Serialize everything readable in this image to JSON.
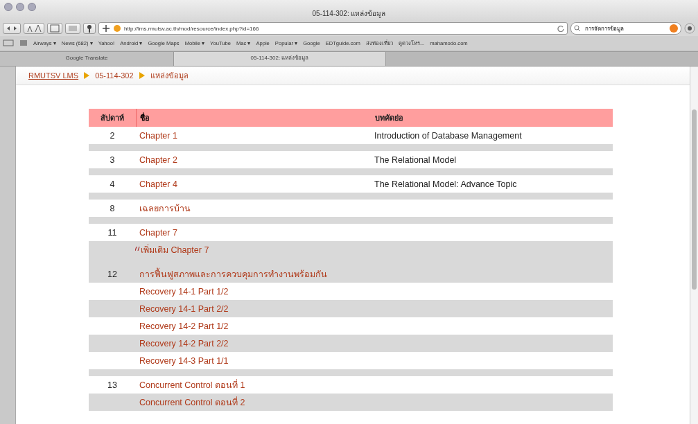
{
  "window": {
    "title": "05-114-302: แหล่งข้อมูล"
  },
  "toolbar": {
    "address": "http://lms.rmutsv.ac.th/mod/resource/index.php?id=166",
    "search": "การจัดการข้อมูล"
  },
  "bookmarks": [
    "Airways ▾",
    "News (682) ▾",
    "Yahoo!",
    "Android ▾",
    "Google Maps",
    "Mobile ▾",
    "YouTube",
    "Mac ▾",
    "Apple",
    "Popular ▾",
    "Google",
    "EDTguide.com",
    "ส่งท่องเที่ยว",
    "ดูดวงโหร...",
    "mahamodo.com"
  ],
  "tabs": [
    {
      "label": "Google Translate",
      "selected": false
    },
    {
      "label": "05-114-302: แหล่งข้อมูล",
      "selected": true
    }
  ],
  "breadcrumb": [
    "RMUTSV LMS",
    "05-114-302",
    "แหล่งข้อมูล"
  ],
  "table": {
    "columns": [
      "สัปดาห์",
      "ชื่อ",
      "บทคัดย่อ"
    ],
    "sections": [
      {
        "week": "2",
        "rows": [
          {
            "name": "Chapter 1",
            "summary": "Introduction of Database Management",
            "shaded": false,
            "kind": "link"
          }
        ]
      },
      {
        "week": "3",
        "rows": [
          {
            "name": "Chapter 2",
            "summary": "The Relational Model",
            "shaded": false,
            "kind": "link"
          }
        ]
      },
      {
        "week": "4",
        "rows": [
          {
            "name": "Chapter 4",
            "summary": "The Relational Model: Advance Topic",
            "shaded": false,
            "kind": "link"
          }
        ]
      },
      {
        "week": "8",
        "rows": [
          {
            "name": "เฉลยการบ้าน",
            "shaded": false,
            "kind": "link"
          }
        ]
      },
      {
        "week": "11",
        "rows": [
          {
            "name": "Chapter 7",
            "shaded": false,
            "kind": "link"
          },
          {
            "name": "เพิ่มเติม Chapter 7",
            "shaded": true,
            "kind": "note"
          }
        ]
      },
      {
        "week": "12",
        "rows": [
          {
            "name": "การฟื้นฟูสภาพและการควบคุมการทำงานพร้อมกัน",
            "shaded": true,
            "kind": "link"
          },
          {
            "name": "Recovery 14-1 Part 1/2",
            "shaded": false,
            "kind": "link"
          },
          {
            "name": "Recovery 14-1 Part 2/2",
            "shaded": true,
            "kind": "link"
          },
          {
            "name": "Recovery 14-2 Part 1/2",
            "shaded": false,
            "kind": "link"
          },
          {
            "name": "Recovery 14-2 Part 2/2",
            "shaded": true,
            "kind": "link"
          },
          {
            "name": "Recovery 14-3 Part 1/1",
            "shaded": false,
            "kind": "link"
          }
        ]
      },
      {
        "week": "13",
        "rows": [
          {
            "name": "Concurrent Control ตอนที่ 1",
            "shaded": false,
            "kind": "link"
          },
          {
            "name": "Concurrent Control ตอนที่ 2",
            "shaded": true,
            "kind": "link"
          }
        ]
      }
    ]
  }
}
